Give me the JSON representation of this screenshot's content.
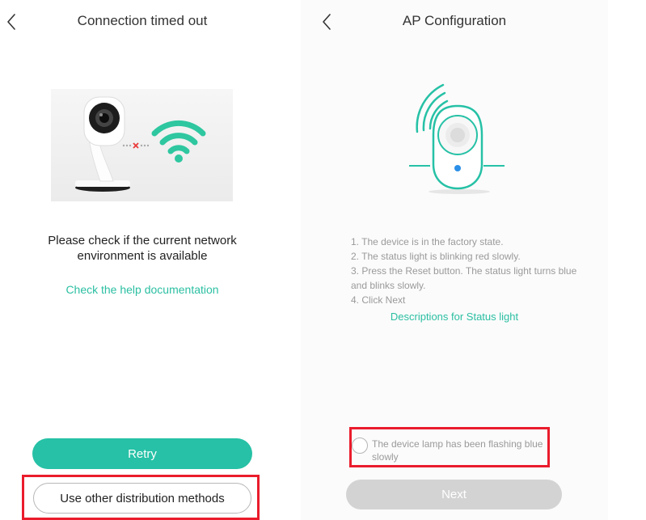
{
  "left_screen": {
    "title": "Connection timed out",
    "message": "Please check if the current network environment is available",
    "help_link": "Check the help documentation",
    "retry_label": "Retry",
    "other_methods_label": "Use other distribution methods",
    "illustration_icons": [
      "camera-icon",
      "disconnected-x-icon",
      "wifi-icon"
    ]
  },
  "right_screen": {
    "title": "AP Configuration",
    "steps": [
      "1. The device is in the factory state.",
      "2. The status light is blinking red slowly.",
      "3. Press the Reset button. The status light turns blue and blinks slowly.",
      "4. Click Next"
    ],
    "status_link": "Descriptions for Status light",
    "confirm_label": "The device lamp has been flashing blue slowly",
    "confirm_checked": false,
    "next_label": "Next",
    "next_enabled": false,
    "illustration_icons": [
      "device-icon",
      "signal-waves-icon"
    ]
  },
  "colors": {
    "accent": "#26c1a6",
    "link": "#2bbfa2",
    "highlight": "#ea1c2c",
    "disabled_button": "#d3d3d3",
    "secondary_text": "#9a9a9a"
  }
}
